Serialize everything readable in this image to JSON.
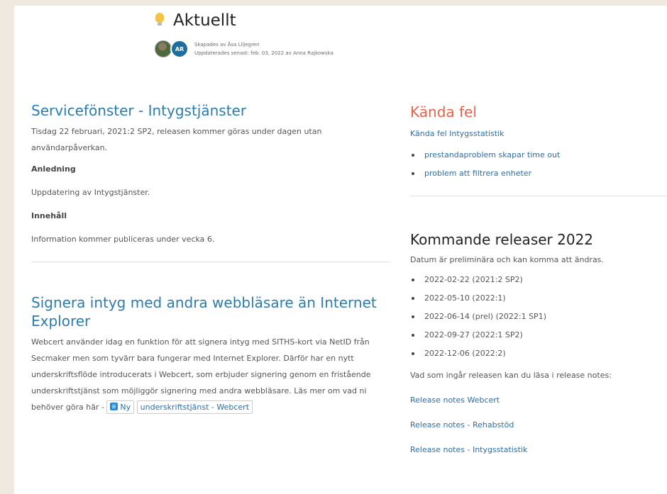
{
  "header": {
    "title": "Aktuellt",
    "avatar_initials": "AR",
    "created_by": "Skapades av Åsa Liljegren",
    "updated": "Uppdaterades senast: feb. 03, 2022 av Anna Rajkowska"
  },
  "service": {
    "heading": "Servicefönster - Intygstjänster",
    "intro": "Tisdag 22 februari, 2021:2 SP2, releasen kommer göras under dagen utan användarpåverkan.",
    "reason_label": "Anledning",
    "reason_text": "Uppdatering av Intygstjänster.",
    "content_label": "Innehåll",
    "content_text": "Information kommer publiceras under vecka 6."
  },
  "sign": {
    "heading": "Signera intyg med andra webbläsare än Internet Explorer",
    "body": "Webcert använder idag en funktion för att signera intyg med SITHS-kort via NetID från Secmaker men som tyvärr bara fungerar med Internet Explorer. Därför har en nytt underskriftsflöde introducerats i Webcert, som erbjuder signering genom en fristående underskriftstjänst som möjliggör signering med andra webbläsare. Läs mer om vad ni behöver göra här -",
    "link_part1": "Ny",
    "link_part2": "underskriftstjänst - Webcert"
  },
  "known_issues": {
    "heading": "Kända fel",
    "link": "Kända fel Intygsstatistik",
    "items": [
      "prestandaproblem skapar time out",
      "problem att filtrera enheter"
    ]
  },
  "releases": {
    "heading": "Kommande releaser 2022",
    "note": "Datum är preliminära och kan komma att ändras.",
    "dates": [
      "2022-02-22 (2021:2 SP2)",
      "2022-05-10 (2022:1)",
      "2022-06-14 (prel) (2022:1 SP1)",
      "2022-09-27 (2022:1 SP2)",
      "2022-12-06 (2022:2)"
    ],
    "notes_intro": "Vad som ingår releasen kan du läsa i release notes:",
    "links": [
      "Release notes Webcert",
      "Release notes - Rehabstöd",
      "Release notes - Intygsstatistik"
    ]
  }
}
